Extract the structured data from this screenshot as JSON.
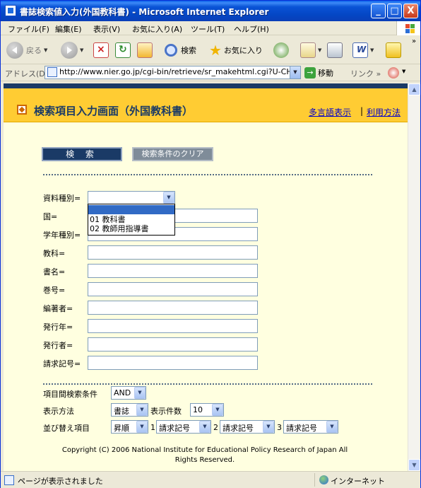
{
  "window": {
    "title": "書誌検索値入力(外国教科書) - Microsoft Internet Explorer",
    "controls": [
      "_",
      "□",
      "X"
    ]
  },
  "menubar": {
    "items": [
      "ファイル(F)",
      "編集(E)",
      "表示(V)",
      "お気に入り(A)",
      "ツール(T)",
      "ヘルプ(H)"
    ]
  },
  "toolbar": {
    "back_label": "戻る",
    "search_label": "検索",
    "favorites_label": "お気に入り",
    "dropdown_arrow": "▼"
  },
  "addressbar": {
    "label": "アドレス(D)",
    "url": "http://www.nier.go.jp/cgi-bin/retrieve/sr_makehtml.cgi?U-CHAI",
    "go_label": "移動",
    "links_label": "リンク",
    "more": "»",
    "dropdown_arrow": "▼"
  },
  "page": {
    "title": "検索項目入力画面（外国教科書）",
    "header_links": {
      "multilang": "多言語表示",
      "separator": "|",
      "usage": "利用方法"
    },
    "buttons": {
      "search": "検 索",
      "clear": "検索条件のクリア"
    },
    "fields": {
      "material_type": "資料種別=",
      "country": "国=",
      "grade_type": "学年種別=",
      "subject": "教科=",
      "book_title": "書名=",
      "volume": "巻号=",
      "editor": "編著者=",
      "pub_year": "発行年=",
      "publisher": "発行者=",
      "call_number": "請求記号="
    },
    "material_dropdown": {
      "selected": "",
      "options": [
        "",
        "01 教科書",
        "02 教師用指導書"
      ]
    },
    "options": {
      "logic_label": "項目間検索条件",
      "logic_value": "AND",
      "display_label": "表示方法",
      "display_value": "書誌",
      "count_label": "表示件数",
      "count_value": "10",
      "sort_label": "並び替え項目",
      "order_value": "昇順",
      "sort1_num": "1",
      "sort1_value": "請求記号",
      "sort2_num": "2",
      "sort2_value": "請求記号",
      "sort3_num": "3",
      "sort3_value": "請求記号"
    },
    "copyright_line1": "Copyright (C) 2006 National Institute for Educational Policy Research of Japan All",
    "copyright_line2": "Rights Reserved."
  },
  "statusbar": {
    "message": "ページが表示されました",
    "zone": "インターネット"
  },
  "icons": {
    "select_arrow": "▼",
    "scroll_up": "▲",
    "scroll_down": "▼"
  }
}
